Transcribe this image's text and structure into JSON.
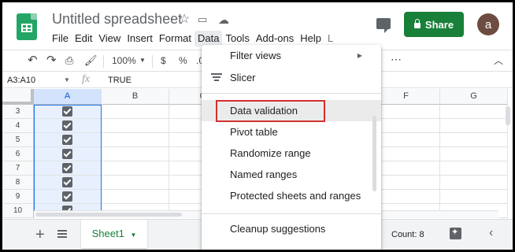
{
  "app": {
    "doc_title": "Untitled spreadsheet"
  },
  "menubar": [
    "File",
    "Edit",
    "View",
    "Insert",
    "Format",
    "Data",
    "Tools",
    "Add-ons",
    "Help",
    "L"
  ],
  "share_label": "Share",
  "avatar_letter": "a",
  "toolbar": {
    "zoom": "100%",
    "currency": "$",
    "percent": "%",
    "decimal": ".0",
    "more": "⋯"
  },
  "formula_bar": {
    "name_box": "A3:A10",
    "fx": "fx",
    "value": "TRUE"
  },
  "columns": [
    "A",
    "B",
    "C",
    "D",
    "E",
    "F",
    "G"
  ],
  "rows": [
    "3",
    "4",
    "5",
    "6",
    "7",
    "8",
    "9",
    "10"
  ],
  "checked_cells": "A3:A10",
  "bottom": {
    "sheet_tab": "Sheet1",
    "count": "Count: 8"
  },
  "data_menu": {
    "items": [
      "Filter views",
      "Slicer",
      "Data validation",
      "Pivot table",
      "Randomize range",
      "Named ranges",
      "Protected sheets and ranges",
      "Cleanup suggestions"
    ],
    "highlighted": "Data validation"
  },
  "colors": {
    "accent": "#1a73e8",
    "share": "#188038",
    "highlight_border": "#d32f2f"
  }
}
